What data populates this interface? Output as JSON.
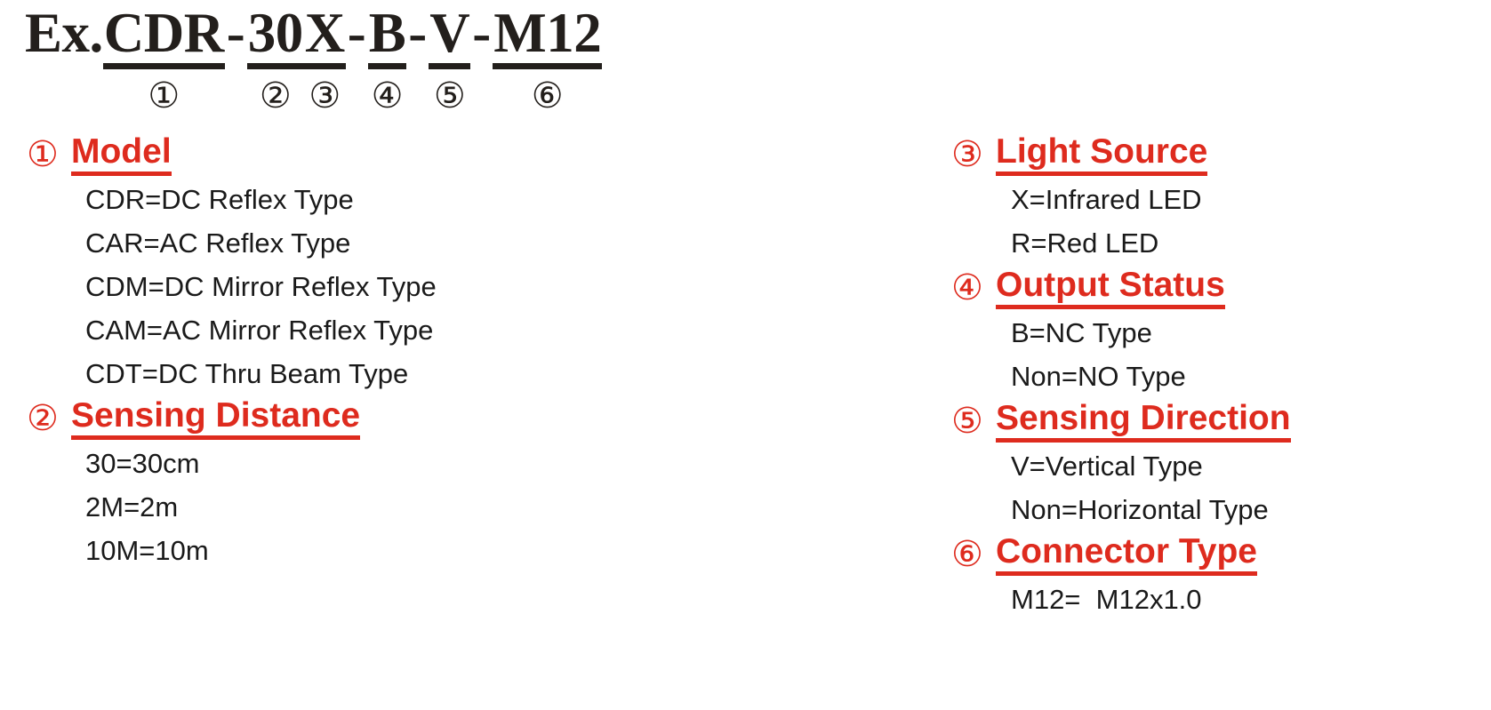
{
  "colors": {
    "accent_red": "#DE2B1E",
    "text_black": "#1a1a1a",
    "header_black": "#231f1c",
    "background": "#ffffff"
  },
  "header": {
    "prefix": "Ex.",
    "segments": [
      {
        "text": "CDR",
        "index": "①"
      },
      {
        "text": "30",
        "index": "②"
      },
      {
        "text": "X",
        "index": "③"
      },
      {
        "text": "B",
        "index": "④"
      },
      {
        "text": "V",
        "index": "⑤"
      },
      {
        "text": "M12",
        "index": "⑥"
      }
    ],
    "separators": [
      "-",
      "",
      "-",
      "-",
      "-"
    ]
  },
  "left_column": {
    "sections": [
      {
        "index": "①",
        "title": "Model",
        "options": [
          "CDR=DC Reflex Type",
          "CAR=AC Reflex Type",
          "CDM=DC Mirror Reflex Type",
          "CAM=AC Mirror Reflex Type",
          "CDT=DC Thru Beam Type"
        ]
      },
      {
        "index": "②",
        "title": "Sensing Distance",
        "options": [
          "30=30cm",
          "2M=2m",
          "10M=10m"
        ]
      }
    ]
  },
  "right_column": {
    "sections": [
      {
        "index": "③",
        "title": "Light Source",
        "options": [
          "X=Infrared LED",
          "R=Red LED"
        ]
      },
      {
        "index": "④",
        "title": "Output Status",
        "options": [
          "B=NC Type",
          "Non=NO Type"
        ]
      },
      {
        "index": "⑤",
        "title": "Sensing Direction",
        "options": [
          "V=Vertical Type",
          "Non=Horizontal Type"
        ]
      },
      {
        "index": "⑥",
        "title": "Connector Type",
        "options": [
          "M12=  M12x1.0"
        ]
      }
    ]
  }
}
